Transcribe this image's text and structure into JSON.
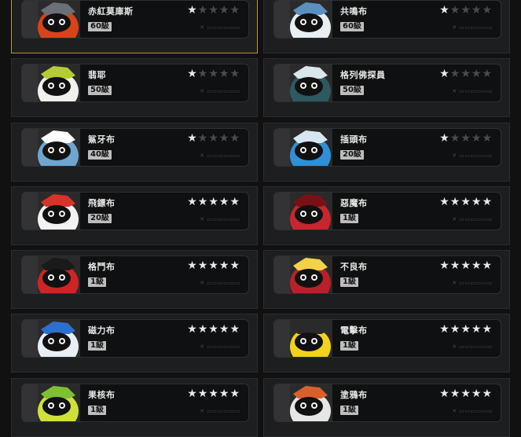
{
  "characters": [
    {
      "name": "赤紅莫庫斯",
      "level": "60級",
      "stars": 1,
      "selected": true,
      "colors": {
        "bg": "#2a2a2a",
        "body": "#d8431a",
        "accent": "#6b6f77"
      }
    },
    {
      "name": "共鳴布",
      "level": "60級",
      "stars": 1,
      "selected": false,
      "colors": {
        "bg": "#2a2a2a",
        "body": "#e9eef2",
        "accent": "#5b8fc0"
      }
    },
    {
      "name": "翡耶",
      "level": "50級",
      "stars": 1,
      "selected": false,
      "colors": {
        "bg": "#2a2a2a",
        "body": "#f0f0ec",
        "accent": "#b6cc34"
      }
    },
    {
      "name": "格列佛探員",
      "level": "50級",
      "stars": 1,
      "selected": false,
      "colors": {
        "bg": "#2a2a2a",
        "body": "#2d5a60",
        "accent": "#d9e6ea"
      }
    },
    {
      "name": "鯊牙布",
      "level": "40級",
      "stars": 1,
      "selected": false,
      "colors": {
        "bg": "#2a2a2a",
        "body": "#6ea6cf",
        "accent": "#ffffff"
      }
    },
    {
      "name": "插頭布",
      "level": "20級",
      "stars": 1,
      "selected": false,
      "colors": {
        "bg": "#2a2a2a",
        "body": "#2f8fd8",
        "accent": "#d8e6f2"
      }
    },
    {
      "name": "飛鏢布",
      "level": "20級",
      "stars": 5,
      "selected": false,
      "colors": {
        "bg": "#2a2a2a",
        "body": "#f2f2f2",
        "accent": "#d9322a"
      }
    },
    {
      "name": "惡魔布",
      "level": "1級",
      "stars": 5,
      "selected": false,
      "colors": {
        "bg": "#2a2a2a",
        "body": "#c7262e",
        "accent": "#7a1016"
      }
    },
    {
      "name": "格鬥布",
      "level": "1級",
      "stars": 5,
      "selected": false,
      "colors": {
        "bg": "#2a2a2a",
        "body": "#cf2424",
        "accent": "#1a1a1a"
      }
    },
    {
      "name": "不良布",
      "level": "1級",
      "stars": 5,
      "selected": false,
      "colors": {
        "bg": "#2a2a2a",
        "body": "#b8212a",
        "accent": "#f1d24a"
      }
    },
    {
      "name": "磁力布",
      "level": "1級",
      "stars": 5,
      "selected": false,
      "colors": {
        "bg": "#2a2a2a",
        "body": "#e9eef5",
        "accent": "#2d6fcf"
      }
    },
    {
      "name": "電擊布",
      "level": "1級",
      "stars": 5,
      "selected": false,
      "colors": {
        "bg": "#2a2a2a",
        "body": "#f2d21a",
        "accent": "#2a2a2a"
      }
    },
    {
      "name": "果核布",
      "level": "1級",
      "stars": 5,
      "selected": false,
      "colors": {
        "bg": "#2a2a2a",
        "body": "#cfe03a",
        "accent": "#7fbf34"
      }
    },
    {
      "name": "塗鴉布",
      "level": "1級",
      "stars": 5,
      "selected": false,
      "colors": {
        "bg": "#2a2a2a",
        "body": "#e6e6e6",
        "accent": "#d9602a"
      }
    }
  ],
  "star_total": 5,
  "icons": {
    "star": "star-icon",
    "decoration": "decorative-pattern-icon"
  },
  "theme": {
    "selected_border": "#b89a2e",
    "star_on": "#e9e9e9",
    "star_off": "#4a4b4e"
  }
}
